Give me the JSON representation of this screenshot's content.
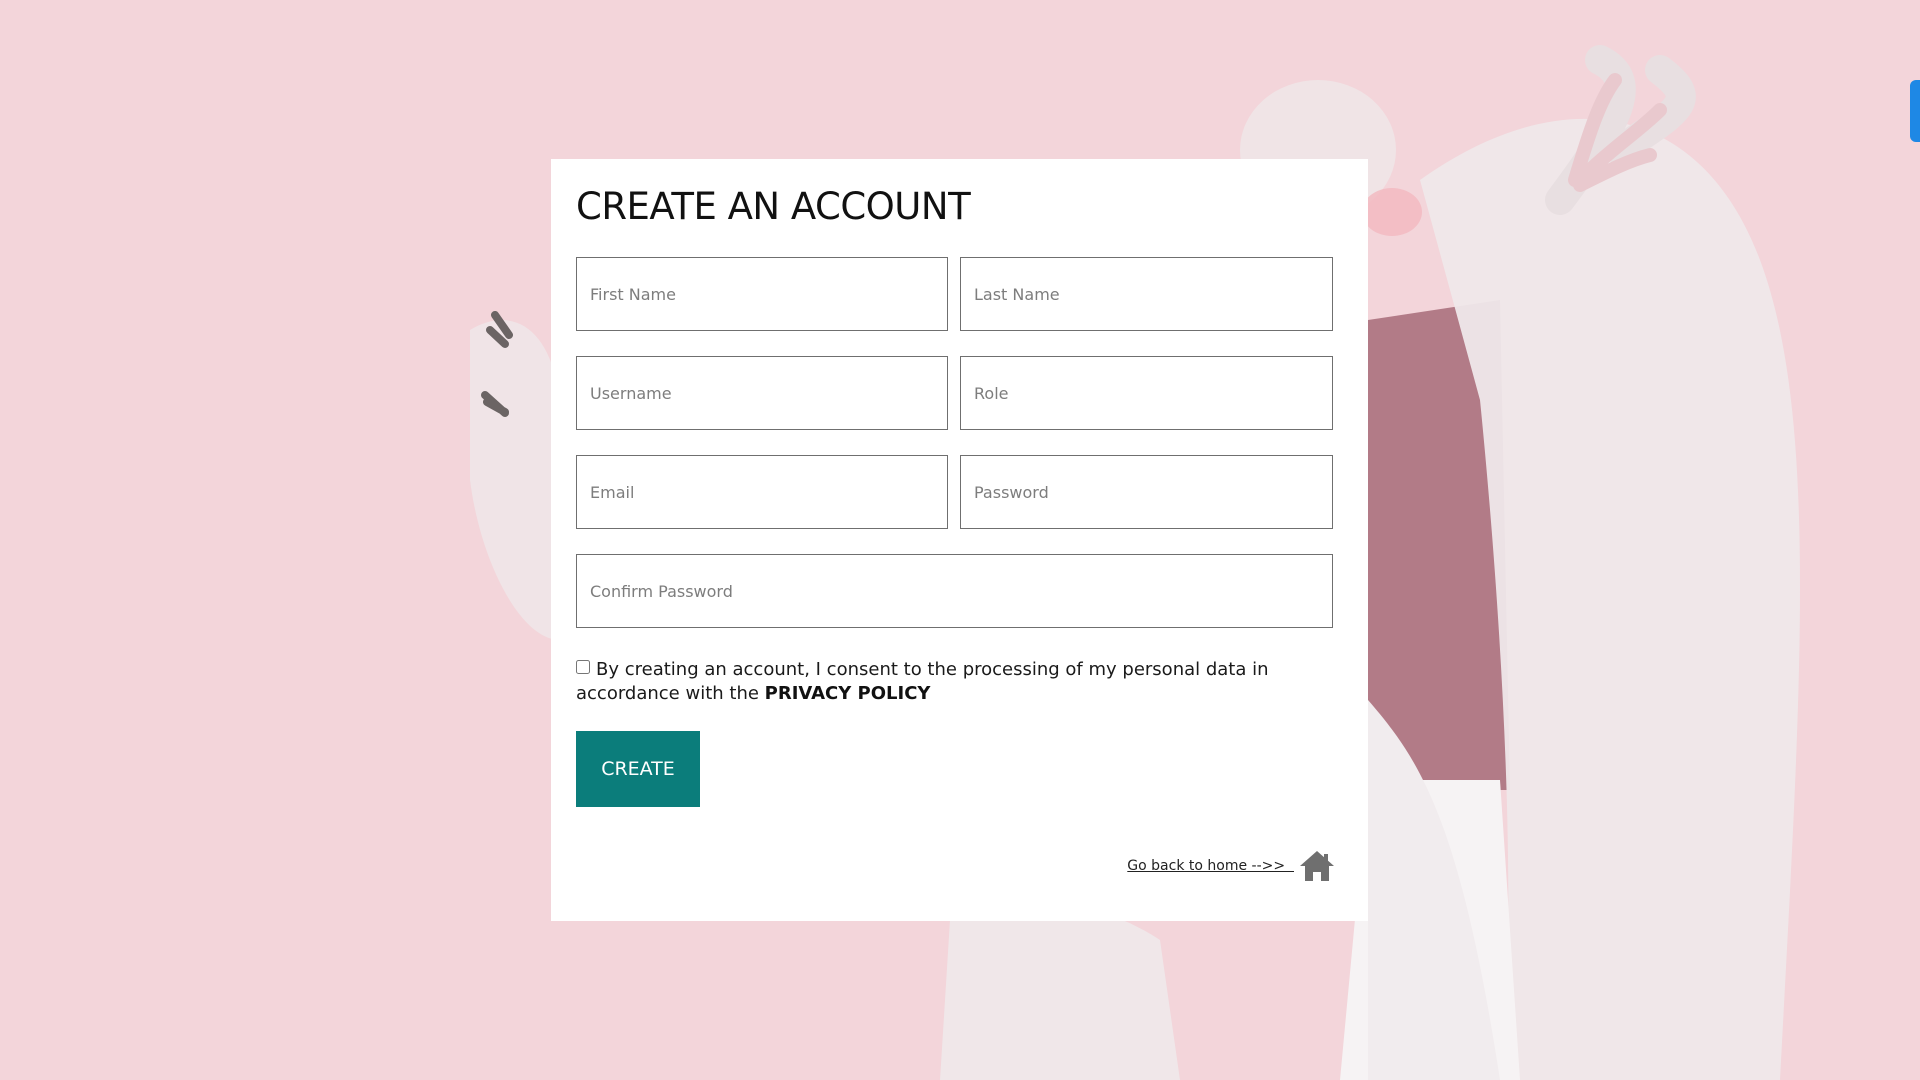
{
  "form": {
    "title": "CREATE AN ACCOUNT",
    "fields": {
      "first_name": "First Name",
      "last_name": "Last Name",
      "username": "Username",
      "role": "Role",
      "email": "Email",
      "password": "Password",
      "confirm_password": "Confirm Password"
    },
    "consent_text": "By creating an account, I consent to the processing of my personal data in accordance with the ",
    "privacy_policy_label": "PRIVACY POLICY",
    "consent_checked": false,
    "create_label": "CREATE",
    "home_link_label": "Go back to home -->>  ",
    "home_icon": "home-icon"
  },
  "colors": {
    "background": "#f3d5da",
    "button": "#0b7d7b",
    "edge_tab": "#1e88e5"
  }
}
